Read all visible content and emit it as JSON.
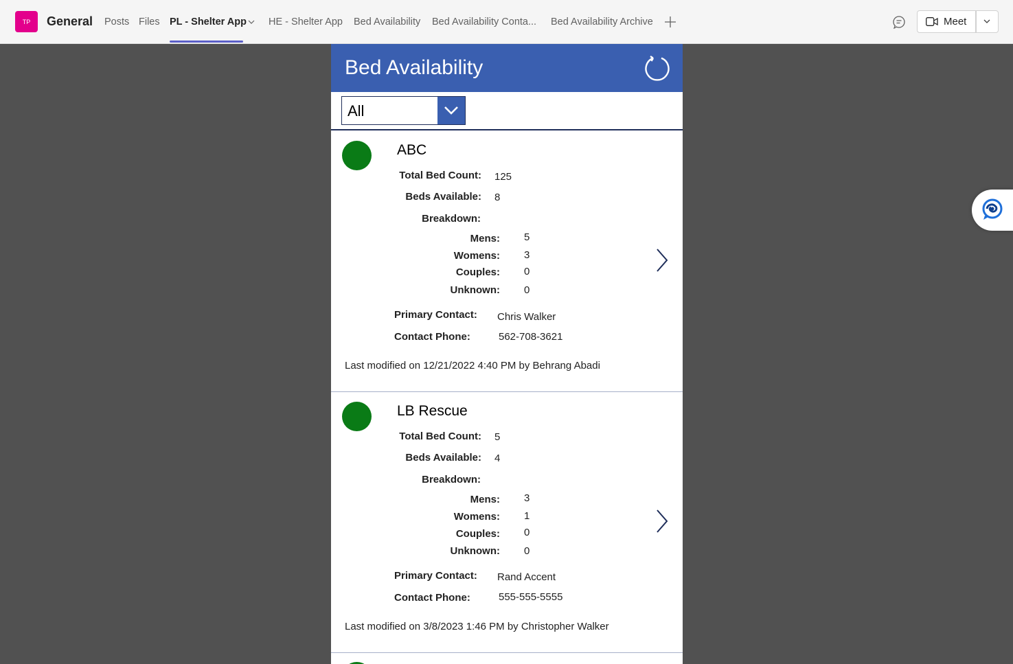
{
  "team": {
    "avatar_initials": "TP",
    "avatar_color": "#e3008c",
    "channel": "General"
  },
  "tabs": [
    "Posts",
    "Files",
    "PL - Shelter App",
    "HE - Shelter App",
    "Bed Availability",
    "Bed Availability Conta...",
    "Bed Availability Archive"
  ],
  "active_tab_index": 2,
  "meet": {
    "label": "Meet"
  },
  "app": {
    "title": "Bed Availability",
    "header_color": "#3a5fb0",
    "filter": {
      "value": "All"
    },
    "labels": {
      "total": "Total Bed Count:",
      "available": "Beds Available:",
      "breakdown": "Breakdown:",
      "mens": "Mens:",
      "womens": "Womens:",
      "couples": "Couples:",
      "unknown": "Unknown:",
      "contact": "Primary Contact:",
      "phone": "Contact Phone:"
    },
    "shelters": [
      {
        "name": "ABC",
        "status_color": "#0a7b16",
        "total": "125",
        "available": "8",
        "mens": "5",
        "womens": "3",
        "couples": "0",
        "unknown": "0",
        "contact": "Chris Walker",
        "phone": "562-708-3621",
        "modified": "Last modified on 12/21/2022 4:40 PM by Behrang Abadi"
      },
      {
        "name": "LB Rescue",
        "status_color": "#0a7b16",
        "total": "5",
        "available": "4",
        "mens": "3",
        "womens": "1",
        "couples": "0",
        "unknown": "0",
        "contact": "Rand Accent",
        "phone": "555-555-5555",
        "modified": "Last modified on 3/8/2023 1:46 PM by Christopher Walker"
      }
    ]
  }
}
